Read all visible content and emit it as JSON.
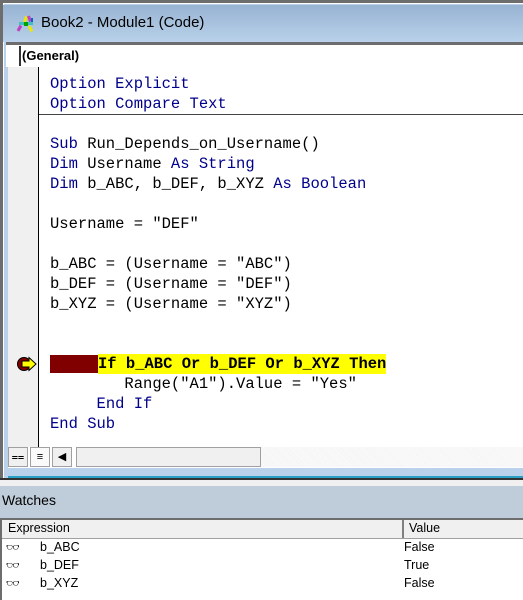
{
  "window": {
    "title": "Book2 - Module1 (Code)",
    "icon": "vba-module-icon"
  },
  "combo": {
    "object_selected": "(General)"
  },
  "code": {
    "lines": [
      {
        "parts": [
          {
            "t": "Option Explicit",
            "kw": true
          }
        ]
      },
      {
        "parts": [
          {
            "t": "Option Compare Text",
            "kw": true
          }
        ]
      },
      {
        "parts": [
          {
            "t": "",
            "kw": false
          }
        ]
      },
      {
        "parts": [
          {
            "t": "Sub",
            "kw": true
          },
          {
            "t": " Run_Depends_on_Username()",
            "kw": false
          }
        ]
      },
      {
        "parts": [
          {
            "t": "Dim",
            "kw": true
          },
          {
            "t": " Username ",
            "kw": false
          },
          {
            "t": "As String",
            "kw": true
          }
        ]
      },
      {
        "parts": [
          {
            "t": "Dim",
            "kw": true
          },
          {
            "t": " b_ABC, b_DEF, b_XYZ ",
            "kw": false
          },
          {
            "t": "As Boolean",
            "kw": true
          }
        ]
      },
      {
        "parts": [
          {
            "t": "",
            "kw": false
          }
        ]
      },
      {
        "parts": [
          {
            "t": "Username = \"DEF\"",
            "kw": false
          }
        ]
      },
      {
        "parts": [
          {
            "t": "",
            "kw": false
          }
        ]
      },
      {
        "parts": [
          {
            "t": "b_ABC = (Username = \"ABC\")",
            "kw": false
          }
        ]
      },
      {
        "parts": [
          {
            "t": "b_DEF = (Username = \"DEF\")",
            "kw": false
          }
        ]
      },
      {
        "parts": [
          {
            "t": "b_XYZ = (Username = \"XYZ\")",
            "kw": false
          }
        ]
      },
      {
        "parts": [
          {
            "t": "",
            "kw": false
          }
        ]
      },
      {
        "parts": [
          {
            "t": "",
            "kw": false
          }
        ]
      },
      {
        "exec": true,
        "parts": [
          {
            "t": "If b_ABC Or b_DEF Or b_XYZ Then",
            "kw": false
          }
        ]
      },
      {
        "parts": [
          {
            "t": "        Range(\"A1\").Value = \"Yes\"",
            "kw": false
          }
        ]
      },
      {
        "parts": [
          {
            "t": "     ",
            "kw": false
          },
          {
            "t": "End If",
            "kw": true
          }
        ]
      },
      {
        "parts": [
          {
            "t": "End Sub",
            "kw": true
          }
        ]
      }
    ],
    "keyword_color": "#00008b",
    "exec_highlight_color": "#ffff00",
    "breakpoint_color": "#800000"
  },
  "scroll": {
    "procedure_view_icon": "procedure-view-icon",
    "full_module_view_icon": "full-module-view-icon",
    "scroll_left_icon": "scroll-left-icon"
  },
  "watches": {
    "title": "Watches",
    "columns": [
      "Expression",
      "Value"
    ],
    "rows": [
      {
        "expression": "b_ABC",
        "value": "False"
      },
      {
        "expression": "b_DEF",
        "value": "True"
      },
      {
        "expression": "b_XYZ",
        "value": "False"
      }
    ]
  }
}
